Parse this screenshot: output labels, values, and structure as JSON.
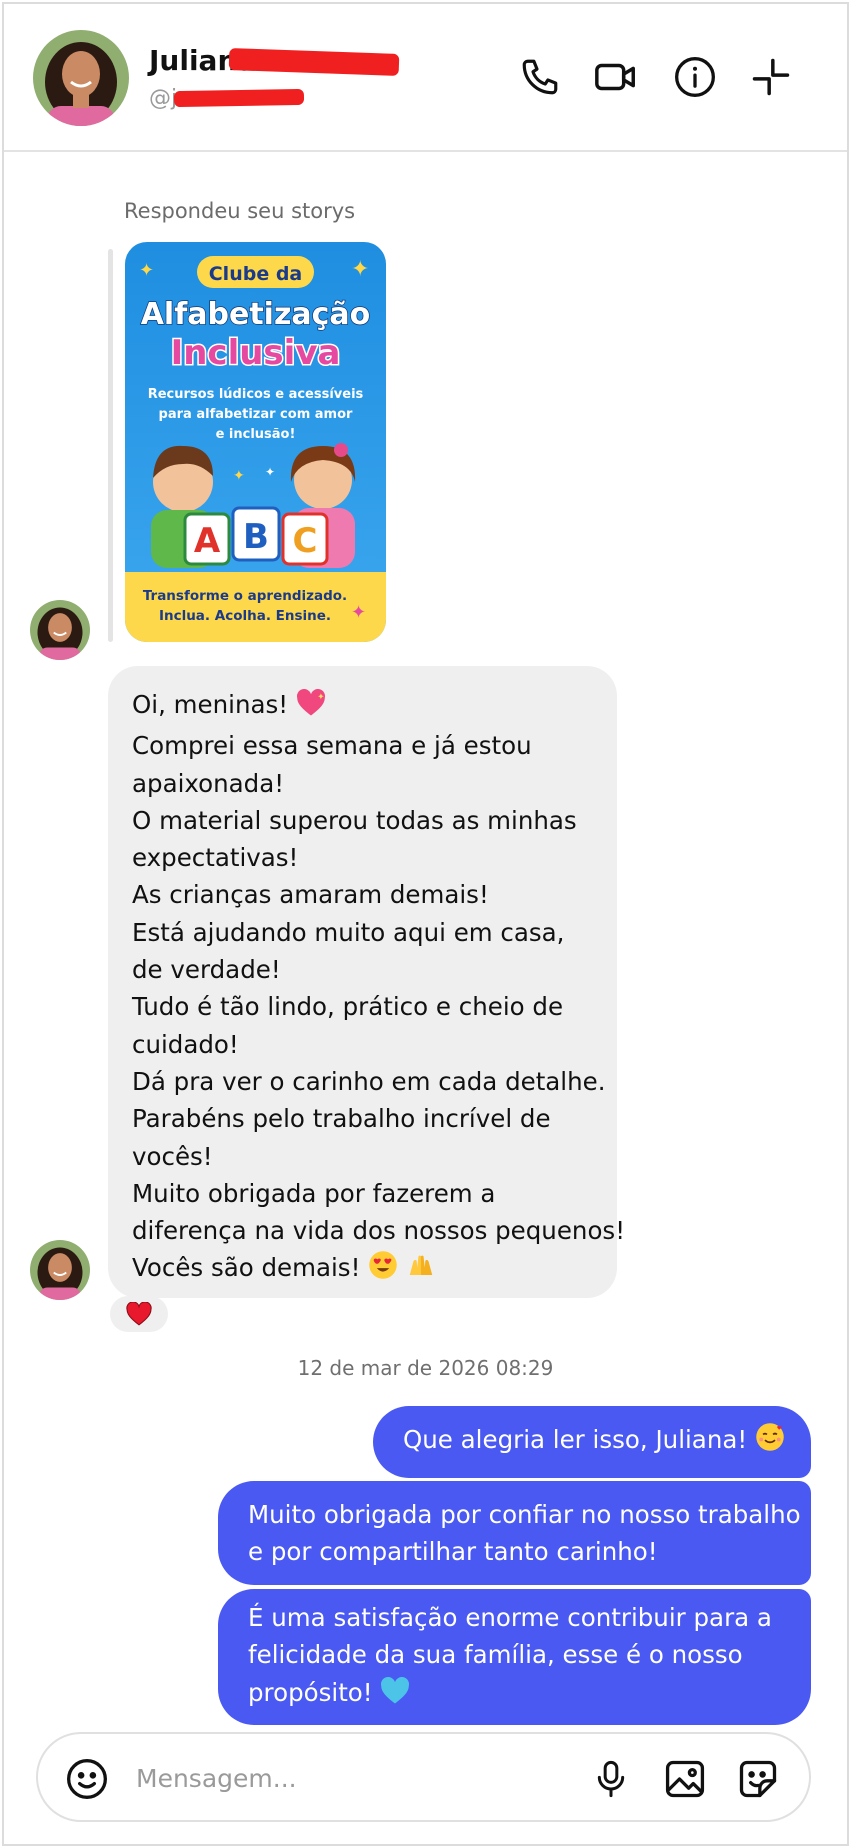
{
  "header": {
    "name": "Juliana F",
    "handle": "@ju                 e"
  },
  "story": {
    "label": "Respondeu seu storys",
    "card": {
      "badge": "Clube da",
      "title_line1": "Alfabetização",
      "title_line2": "Inclusiva",
      "subtitle": [
        "Recursos lúdicos e acessíveis",
        "para alfabetizar com amor",
        "e inclusão!"
      ],
      "blocks": [
        "A",
        "B",
        "C"
      ],
      "footer": [
        "Transforme o aprendizado.",
        "Inclua. Acolha. Ensine."
      ]
    }
  },
  "incoming": {
    "lines": [
      "Oi, meninas!",
      "Comprei essa semana e já estou",
      "apaixonada!",
      "O material superou todas as minhas",
      "expectativas!",
      "As crianças amaram demais!",
      "Está ajudando muito aqui em casa,",
      "de verdade!",
      "Tudo é tão lindo, prático e cheio de",
      "cuidado!",
      "Dá pra ver o carinho em cada detalhe.",
      "Parabéns pelo trabalho incrível de",
      "vocês!",
      "Muito obrigada por fazerem a",
      "diferença na vida dos nossos pequenos!",
      "Vocês são demais!"
    ],
    "reaction": "heart"
  },
  "timestamp": "12 de mar de 2026 08:29",
  "outgoing": [
    {
      "lines": [
        "Que alegria ler isso, Juliana!"
      ]
    },
    {
      "lines": [
        "Muito obrigada por confiar no nosso trabalho",
        "e por compartilhar tanto carinho!"
      ]
    },
    {
      "lines": [
        "É uma satisfação enorme contribuir para a",
        "felicidade da sua família, esse é o nosso",
        "propósito!"
      ]
    }
  ],
  "composer": {
    "placeholder": "Mensagem..."
  },
  "colors": {
    "outgoing_bubble": "#4a59f2",
    "incoming_bubble": "#efeff0",
    "redaction": "#f02020"
  }
}
